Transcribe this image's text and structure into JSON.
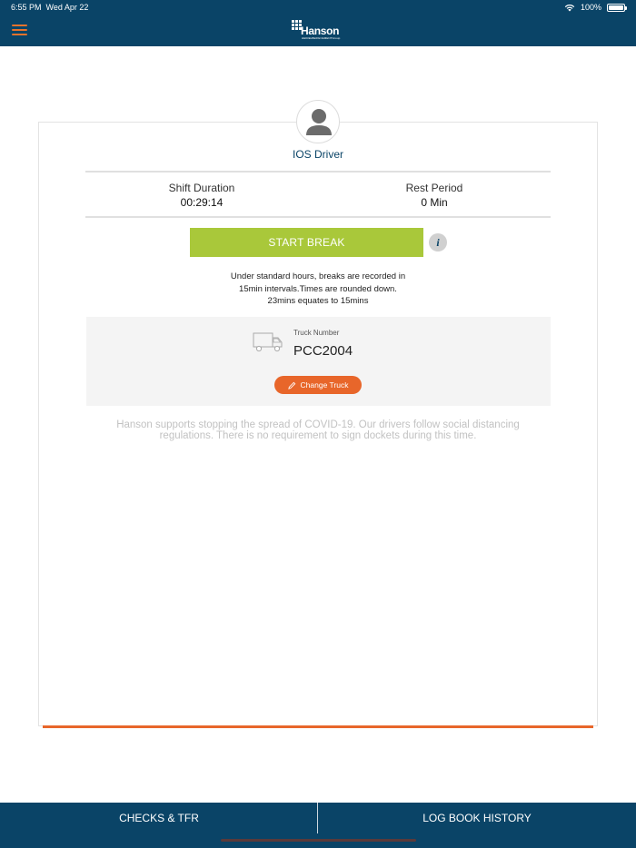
{
  "status_bar": {
    "time": "6:55 PM",
    "date": "Wed Apr 22",
    "battery": "100%"
  },
  "header": {
    "logo_text": "Hanson",
    "logo_subtext": "HEIDELBERGCEMENTGroup"
  },
  "driver": {
    "name": "IOS Driver"
  },
  "shift": {
    "duration_label": "Shift Duration",
    "duration_value": "00:29:14",
    "rest_label": "Rest Period",
    "rest_value": "0 Min"
  },
  "break": {
    "button_label": "START BREAK",
    "info_label": "i",
    "note_line1": "Under standard hours, breaks are recorded in",
    "note_line2": "15min intervals.Times are rounded down.",
    "note_line3": "23mins equates to 15mins"
  },
  "truck": {
    "label": "Truck Number",
    "number": "PCC2004",
    "change_label": "Change Truck"
  },
  "covid_notice": {
    "line1": "Hanson supports stopping the spread of COVID-19. Our drivers follow social distancing",
    "line2": "regulations. There is no requirement to sign dockets during this time."
  },
  "bottom_nav": {
    "left_label": "CHECKS & TFR",
    "right_label": "LOG BOOK HISTORY"
  },
  "colors": {
    "navy": "#0a4467",
    "green": "#a9c83a",
    "orange": "#e8662a"
  },
  "icons": {
    "menu": "hamburger-icon",
    "avatar": "user-icon",
    "info": "info-icon",
    "truck": "truck-icon",
    "pencil": "pencil-icon",
    "wifi": "wifi-icon",
    "battery": "battery-icon"
  }
}
